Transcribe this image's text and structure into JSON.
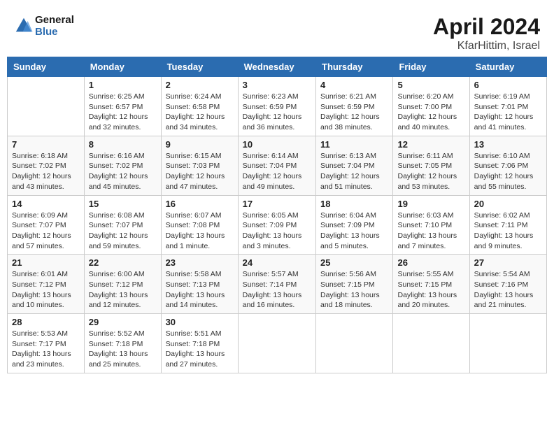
{
  "logo": {
    "line1": "General",
    "line2": "Blue"
  },
  "title": "April 2024",
  "subtitle": "KfarHittim, Israel",
  "days_of_week": [
    "Sunday",
    "Monday",
    "Tuesday",
    "Wednesday",
    "Thursday",
    "Friday",
    "Saturday"
  ],
  "weeks": [
    [
      {
        "num": "",
        "info": ""
      },
      {
        "num": "1",
        "info": "Sunrise: 6:25 AM\nSunset: 6:57 PM\nDaylight: 12 hours\nand 32 minutes."
      },
      {
        "num": "2",
        "info": "Sunrise: 6:24 AM\nSunset: 6:58 PM\nDaylight: 12 hours\nand 34 minutes."
      },
      {
        "num": "3",
        "info": "Sunrise: 6:23 AM\nSunset: 6:59 PM\nDaylight: 12 hours\nand 36 minutes."
      },
      {
        "num": "4",
        "info": "Sunrise: 6:21 AM\nSunset: 6:59 PM\nDaylight: 12 hours\nand 38 minutes."
      },
      {
        "num": "5",
        "info": "Sunrise: 6:20 AM\nSunset: 7:00 PM\nDaylight: 12 hours\nand 40 minutes."
      },
      {
        "num": "6",
        "info": "Sunrise: 6:19 AM\nSunset: 7:01 PM\nDaylight: 12 hours\nand 41 minutes."
      }
    ],
    [
      {
        "num": "7",
        "info": "Sunrise: 6:18 AM\nSunset: 7:02 PM\nDaylight: 12 hours\nand 43 minutes."
      },
      {
        "num": "8",
        "info": "Sunrise: 6:16 AM\nSunset: 7:02 PM\nDaylight: 12 hours\nand 45 minutes."
      },
      {
        "num": "9",
        "info": "Sunrise: 6:15 AM\nSunset: 7:03 PM\nDaylight: 12 hours\nand 47 minutes."
      },
      {
        "num": "10",
        "info": "Sunrise: 6:14 AM\nSunset: 7:04 PM\nDaylight: 12 hours\nand 49 minutes."
      },
      {
        "num": "11",
        "info": "Sunrise: 6:13 AM\nSunset: 7:04 PM\nDaylight: 12 hours\nand 51 minutes."
      },
      {
        "num": "12",
        "info": "Sunrise: 6:11 AM\nSunset: 7:05 PM\nDaylight: 12 hours\nand 53 minutes."
      },
      {
        "num": "13",
        "info": "Sunrise: 6:10 AM\nSunset: 7:06 PM\nDaylight: 12 hours\nand 55 minutes."
      }
    ],
    [
      {
        "num": "14",
        "info": "Sunrise: 6:09 AM\nSunset: 7:07 PM\nDaylight: 12 hours\nand 57 minutes."
      },
      {
        "num": "15",
        "info": "Sunrise: 6:08 AM\nSunset: 7:07 PM\nDaylight: 12 hours\nand 59 minutes."
      },
      {
        "num": "16",
        "info": "Sunrise: 6:07 AM\nSunset: 7:08 PM\nDaylight: 13 hours\nand 1 minute."
      },
      {
        "num": "17",
        "info": "Sunrise: 6:05 AM\nSunset: 7:09 PM\nDaylight: 13 hours\nand 3 minutes."
      },
      {
        "num": "18",
        "info": "Sunrise: 6:04 AM\nSunset: 7:09 PM\nDaylight: 13 hours\nand 5 minutes."
      },
      {
        "num": "19",
        "info": "Sunrise: 6:03 AM\nSunset: 7:10 PM\nDaylight: 13 hours\nand 7 minutes."
      },
      {
        "num": "20",
        "info": "Sunrise: 6:02 AM\nSunset: 7:11 PM\nDaylight: 13 hours\nand 9 minutes."
      }
    ],
    [
      {
        "num": "21",
        "info": "Sunrise: 6:01 AM\nSunset: 7:12 PM\nDaylight: 13 hours\nand 10 minutes."
      },
      {
        "num": "22",
        "info": "Sunrise: 6:00 AM\nSunset: 7:12 PM\nDaylight: 13 hours\nand 12 minutes."
      },
      {
        "num": "23",
        "info": "Sunrise: 5:58 AM\nSunset: 7:13 PM\nDaylight: 13 hours\nand 14 minutes."
      },
      {
        "num": "24",
        "info": "Sunrise: 5:57 AM\nSunset: 7:14 PM\nDaylight: 13 hours\nand 16 minutes."
      },
      {
        "num": "25",
        "info": "Sunrise: 5:56 AM\nSunset: 7:15 PM\nDaylight: 13 hours\nand 18 minutes."
      },
      {
        "num": "26",
        "info": "Sunrise: 5:55 AM\nSunset: 7:15 PM\nDaylight: 13 hours\nand 20 minutes."
      },
      {
        "num": "27",
        "info": "Sunrise: 5:54 AM\nSunset: 7:16 PM\nDaylight: 13 hours\nand 21 minutes."
      }
    ],
    [
      {
        "num": "28",
        "info": "Sunrise: 5:53 AM\nSunset: 7:17 PM\nDaylight: 13 hours\nand 23 minutes."
      },
      {
        "num": "29",
        "info": "Sunrise: 5:52 AM\nSunset: 7:18 PM\nDaylight: 13 hours\nand 25 minutes."
      },
      {
        "num": "30",
        "info": "Sunrise: 5:51 AM\nSunset: 7:18 PM\nDaylight: 13 hours\nand 27 minutes."
      },
      {
        "num": "",
        "info": ""
      },
      {
        "num": "",
        "info": ""
      },
      {
        "num": "",
        "info": ""
      },
      {
        "num": "",
        "info": ""
      }
    ]
  ]
}
